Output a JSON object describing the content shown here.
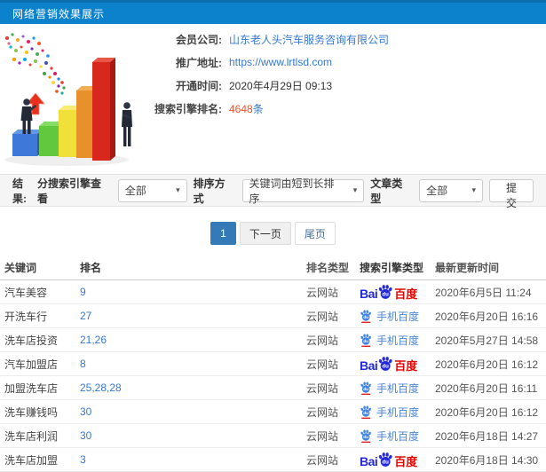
{
  "header": {
    "title": "网络营销效果展示"
  },
  "info": {
    "rows": [
      {
        "label": "会员公司:",
        "value": "山东老人头汽车服务咨询有限公司"
      },
      {
        "label": "推广地址:",
        "value": "https://www.lrtlsd.com"
      },
      {
        "label": "开通时间:",
        "value": "2020年4月29日 09:13"
      },
      {
        "label": "搜索引擎排名:",
        "value": "4648",
        "suffix": "条"
      }
    ]
  },
  "filter": {
    "result_label": "结果:",
    "engine_label": "分搜索引擎查看",
    "engine_value": "全部",
    "sort_label": "排序方式",
    "sort_value": "关键词由短到长排序",
    "article_label": "文章类型",
    "article_value": "全部",
    "submit_label": "提交",
    "caret": "▾"
  },
  "pagination": {
    "current": "1",
    "next": "下一页",
    "last": "尾页"
  },
  "engine_labels": {
    "baidu_bai": "Bai",
    "baidu_du": "du",
    "baidu_cn": "百度",
    "mobile": "手机百度"
  },
  "table": {
    "headers": [
      "关键词",
      "排名",
      "排名类型",
      "搜索引擎类型",
      "最新更新时间"
    ],
    "rows": [
      {
        "keyword": "汽车美容",
        "rank": "9",
        "rank_type": "云网站",
        "engine": "baidu",
        "updated": "2020年6月5日 11:24"
      },
      {
        "keyword": "开洗车行",
        "rank": "27",
        "rank_type": "云网站",
        "engine": "mobile-baidu",
        "updated": "2020年6月20日 16:16"
      },
      {
        "keyword": "洗车店投资",
        "rank": "21,26",
        "rank_type": "云网站",
        "engine": "mobile-baidu",
        "updated": "2020年5月27日 14:58"
      },
      {
        "keyword": "汽车加盟店",
        "rank": "8",
        "rank_type": "云网站",
        "engine": "baidu",
        "updated": "2020年6月20日 16:12"
      },
      {
        "keyword": "加盟洗车店",
        "rank": "25,28,28",
        "rank_type": "云网站",
        "engine": "mobile-baidu",
        "updated": "2020年6月20日 16:11"
      },
      {
        "keyword": "洗车赚钱吗",
        "rank": "30",
        "rank_type": "云网站",
        "engine": "mobile-baidu",
        "updated": "2020年6月20日 16:12"
      },
      {
        "keyword": "洗车店利润",
        "rank": "30",
        "rank_type": "云网站",
        "engine": "mobile-baidu",
        "updated": "2020年6月18日 14:27"
      },
      {
        "keyword": "洗车店加盟",
        "rank": "3",
        "rank_type": "云网站",
        "engine": "baidu",
        "updated": "2020年6月18日 14:30"
      }
    ]
  },
  "colors": {
    "header_blue": "#0c82cc",
    "link_blue": "#3679d2",
    "highlight_orange": "#f4502c",
    "active_page_blue": "#337ab7",
    "baidu_blue": "#2529dc",
    "baidu_red": "#e10601",
    "mobile_baidu_blue": "#4a86d8"
  }
}
